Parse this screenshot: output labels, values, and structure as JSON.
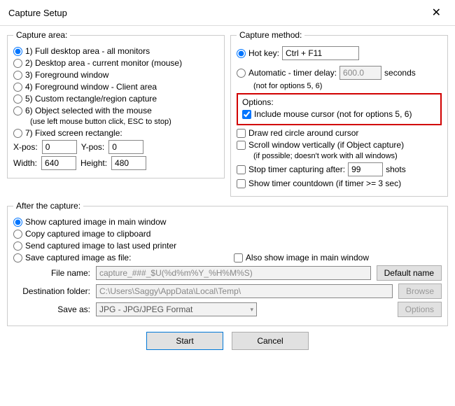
{
  "title": "Capture Setup",
  "close_glyph": "✕",
  "captureArea": {
    "legend": "Capture area:",
    "opt1": "1) Full desktop area - all monitors",
    "opt2": "2) Desktop area - current monitor (mouse)",
    "opt3": "3) Foreground window",
    "opt4": "4) Foreground window - Client area",
    "opt5": "5) Custom rectangle/region capture",
    "opt6": "6) Object selected with the mouse",
    "opt6_note": "(use left mouse button click, ESC to stop)",
    "opt7": "7) Fixed screen rectangle:",
    "xpos_label": "X-pos:",
    "xpos": "0",
    "ypos_label": "Y-pos:",
    "ypos": "0",
    "width_label": "Width:",
    "width": "640",
    "height_label": "Height:",
    "height": "480"
  },
  "captureMethod": {
    "legend": "Capture method:",
    "hotkey_label": "Hot key:",
    "hotkey": "Ctrl + F11",
    "auto_label": "Automatic - timer delay:",
    "auto_note": "(not for options 5, 6)",
    "auto_value": "600.0",
    "auto_seconds": "seconds"
  },
  "options": {
    "legend": "Options:",
    "include_cursor": "Include mouse cursor (not for options 5, 6)",
    "draw_circle": "Draw red circle around cursor",
    "scroll_vert": "Scroll window vertically (if Object capture)",
    "scroll_note": "(if possible; doesn't work with all windows)",
    "stop_after": "Stop timer capturing after:",
    "stop_shots": "99",
    "stop_shots_unit": "shots",
    "show_countdown": "Show timer countdown (if timer >= 3 sec)"
  },
  "after": {
    "legend": "After the capture:",
    "show_main": "Show captured image in main window",
    "copy_clip": "Copy captured image to clipboard",
    "send_printer": "Send captured image to last used printer",
    "save_file": "Save captured image as file:",
    "also_show": "Also show image in main window",
    "file_label": "File name:",
    "file_value": "capture_###_$U(%d%m%Y_%H%M%S)",
    "default_name_btn": "Default name",
    "dest_label": "Destination folder:",
    "dest_value": "C:\\Users\\Saggy\\AppData\\Local\\Temp\\",
    "browse_btn": "Browse",
    "saveas_label": "Save as:",
    "saveas_value": "JPG - JPG/JPEG Format",
    "options_btn": "Options"
  },
  "buttons": {
    "start": "Start",
    "cancel": "Cancel"
  }
}
